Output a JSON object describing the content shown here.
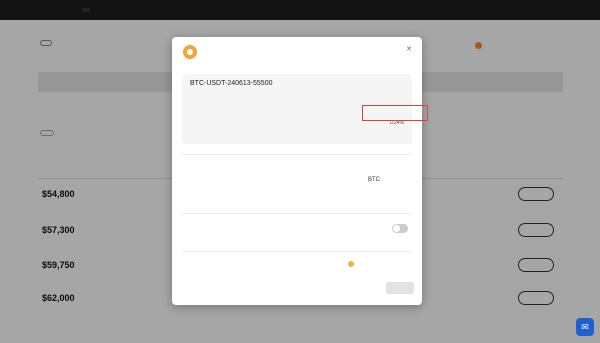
{
  "topnav": {
    "items": [
      "",
      "",
      "",
      ""
    ],
    "active_index": 2,
    "right": ""
  },
  "page": {
    "header_button": "",
    "header_text": "",
    "asset_text": "",
    "banner_text": "",
    "filter_text": "",
    "tabs": [
      "",
      "",
      "",
      ""
    ],
    "list_header": "",
    "rows": [
      {
        "price": "$54,800",
        "change": "",
        "button": ""
      },
      {
        "price": "$57,300",
        "change": "",
        "button": ""
      },
      {
        "price": "$59,750",
        "change": "",
        "button": ""
      },
      {
        "price": "$62,000",
        "change": "",
        "button": ""
      }
    ],
    "footer_text": ""
  },
  "modal": {
    "title": "",
    "subtitle": "",
    "product_id": "BTC-USDT-240613-55500",
    "info_rows": [
      {
        "label": "",
        "value": ""
      },
      {
        "label": "",
        "value": "",
        "highlight": true
      },
      {
        "label": "",
        "value": "0.24%"
      },
      {
        "label": "",
        "value": ""
      }
    ],
    "amount_section_label": "",
    "amount_right": "",
    "amount_placeholder": "",
    "amount_unit": "BTC",
    "amount_max": "",
    "available_label": "",
    "available_value": "",
    "available_right": "",
    "auto_label": "",
    "auto_desc": "",
    "summary_label": "",
    "summary_right": "",
    "cancel_label": "",
    "confirm_label": ""
  },
  "colors": {
    "nav_bg": "#1e1e1e",
    "btc_orange": "#f3a53a",
    "highlight_red": "#e0403a",
    "chat_blue": "#1f5fcf"
  }
}
